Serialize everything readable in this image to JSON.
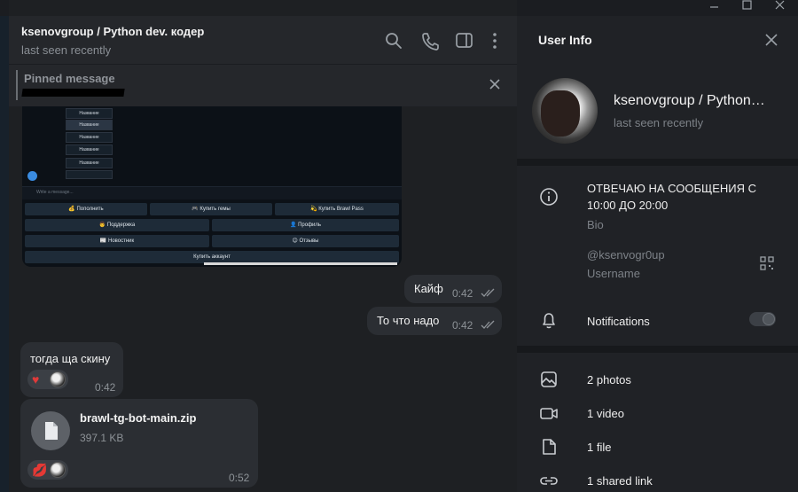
{
  "chat": {
    "title": "ksenovgroup / Python dev. кодер",
    "status": "last seen recently",
    "pinned_label": "Pinned message"
  },
  "bot_screenshot": {
    "menu_items": [
      "Название",
      "Название",
      "Название",
      "Название",
      "Название"
    ],
    "input_placeholder": "Write a message...",
    "buttons_row1": [
      "💰 Пополнить",
      "🎮 Купить гемы",
      "💫 Купить Brawl Pass"
    ],
    "buttons_row2": [
      "👨 Поддержка",
      "👤 Профиль"
    ],
    "buttons_row3": [
      "📰 Новостник",
      "😊 Отзывы"
    ],
    "buttons_row4": [
      "Купить аккаунт"
    ]
  },
  "messages": [
    {
      "direction": "out",
      "text": "Кайф",
      "time": "0:42"
    },
    {
      "direction": "out",
      "text": "То что надо",
      "time": "0:42"
    },
    {
      "direction": "in",
      "text": "тогда ща скину",
      "time": "0:42"
    },
    {
      "direction": "in",
      "file_name": "brawl-tg-bot-main.zip",
      "file_size": "397.1 KB",
      "time": "0:52"
    }
  ],
  "panel": {
    "title": "User Info",
    "name": "ksenovgroup / Python…",
    "seen": "last seen recently",
    "bio_line1": "ОТВЕЧАЮ НА СООБЩЕНИЯ С",
    "bio_line2": "10:00 ДО 20:00",
    "bio_label": "Bio",
    "username": "@ksenvogr0up",
    "username_label": "Username",
    "notifications_label": "Notifications",
    "notifications_enabled": false,
    "media": [
      {
        "icon": "photo-icon",
        "label": "2 photos"
      },
      {
        "icon": "video-icon",
        "label": "1 video"
      },
      {
        "icon": "file-icon",
        "label": "1 file"
      },
      {
        "icon": "link-icon",
        "label": "1 shared link"
      }
    ]
  },
  "colors": {
    "chat_bg": "#1e2023",
    "header_bg": "#25272b",
    "panel_bg": "#202226",
    "bubble_bg": "#2b2e33",
    "secondary_text": "#7c8187"
  }
}
